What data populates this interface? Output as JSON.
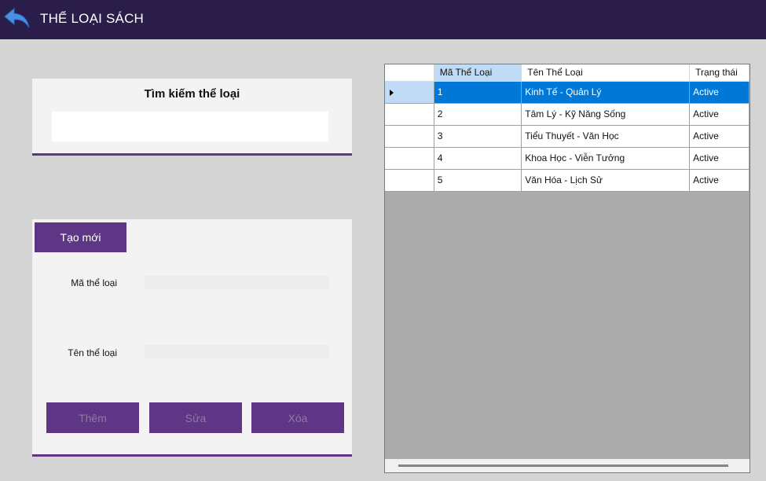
{
  "header": {
    "title": "THỂ LOẠI SÁCH",
    "back_icon": "back-arrow-icon",
    "background": "#2a1d4a"
  },
  "search": {
    "title": "Tìm kiếm thể loại",
    "value": "",
    "placeholder": ""
  },
  "form": {
    "new_button": "Tạo mới",
    "code_label": "Mã thể loại",
    "code_value": "",
    "name_label": "Tên thể loại",
    "name_value": "",
    "add_button": "Thêm",
    "edit_button": "Sửa",
    "delete_button": "Xóa",
    "accent": "#5f3585"
  },
  "grid": {
    "columns": [
      "Mã Thể Loại",
      "Tên Thể Loại",
      "Trạng thái"
    ],
    "rows": [
      {
        "id": "1",
        "name": "Kinh Tế - Quản Lý",
        "status": "Active"
      },
      {
        "id": "2",
        "name": "Tâm Lý - Kỹ Năng Sống",
        "status": "Active"
      },
      {
        "id": "3",
        "name": "Tiểu Thuyết - Văn Học",
        "status": "Active"
      },
      {
        "id": "4",
        "name": "Khoa Học - Viễn Tưởng",
        "status": "Active"
      },
      {
        "id": "5",
        "name": "Văn Hóa - Lịch Sử",
        "status": "Active"
      }
    ],
    "selected_row": 1,
    "selection_color": "#0078d7"
  }
}
